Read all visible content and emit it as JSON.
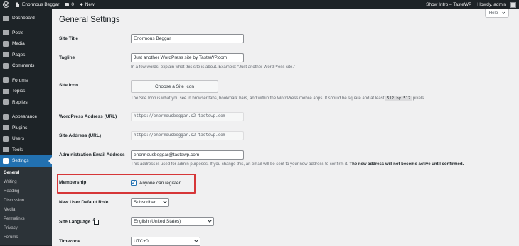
{
  "adminbar": {
    "site_name": "Enormous Beggar",
    "comments_count": "0",
    "new_label": "New",
    "show_intro": "Show Intro – TasteWP",
    "howdy": "Howdy, admin"
  },
  "sidebar": {
    "items": [
      {
        "label": "Dashboard",
        "icon": "dashboard-icon"
      },
      {
        "label": "Posts",
        "icon": "pin-icon"
      },
      {
        "label": "Media",
        "icon": "media-icon"
      },
      {
        "label": "Pages",
        "icon": "page-icon"
      },
      {
        "label": "Comments",
        "icon": "comment-icon"
      },
      {
        "label": "Forums",
        "icon": "forum-icon"
      },
      {
        "label": "Topics",
        "icon": "topic-icon"
      },
      {
        "label": "Replies",
        "icon": "reply-icon"
      },
      {
        "label": "Appearance",
        "icon": "brush-icon"
      },
      {
        "label": "Plugins",
        "icon": "plugin-icon"
      },
      {
        "label": "Users",
        "icon": "users-icon"
      },
      {
        "label": "Tools",
        "icon": "wrench-icon"
      },
      {
        "label": "Settings",
        "icon": "settings-icon"
      }
    ],
    "submenu": [
      "General",
      "Writing",
      "Reading",
      "Discussion",
      "Media",
      "Permalinks",
      "Privacy",
      "Forums"
    ]
  },
  "help_label": "Help",
  "page_title": "General Settings",
  "fields": {
    "site_title": {
      "label": "Site Title",
      "value": "Enormous Beggar"
    },
    "tagline": {
      "label": "Tagline",
      "value": "Just another WordPress site by TasteWP.com",
      "desc": "In a few words, explain what this site is about. Example: “Just another WordPress site.”"
    },
    "site_icon": {
      "label": "Site Icon",
      "button": "Choose a Site Icon",
      "desc_before": "The Site Icon is what you see in browser tabs, bookmark bars, and within the WordPress mobile apps. It should be square and at least",
      "size1": "512",
      "size_by": "by",
      "size2": "512",
      "desc_after": "pixels."
    },
    "wp_address": {
      "label": "WordPress Address (URL)",
      "value": "https://enormousbeggar.s2-tastewp.com"
    },
    "site_address": {
      "label": "Site Address (URL)",
      "value": "https://enormousbeggar.s2-tastewp.com"
    },
    "admin_email": {
      "label": "Administration Email Address",
      "value": "enormousbeggar@tastewp.com",
      "desc": "This address is used for admin purposes. If you change this, an email will be sent to your new address to confirm it.",
      "desc_bold": "The new address will not become active until confirmed."
    },
    "membership": {
      "label": "Membership",
      "checkbox_label": "Anyone can register",
      "checked": true
    },
    "default_role": {
      "label": "New User Default Role",
      "value": "Subscriber"
    },
    "site_language": {
      "label": "Site Language",
      "value": "English (United States)"
    },
    "timezone": {
      "label": "Timezone",
      "value": "UTC+0"
    }
  },
  "colors": {
    "accent": "#2271b1",
    "highlight": "#d63638",
    "admin_bar": "#1d2327"
  }
}
